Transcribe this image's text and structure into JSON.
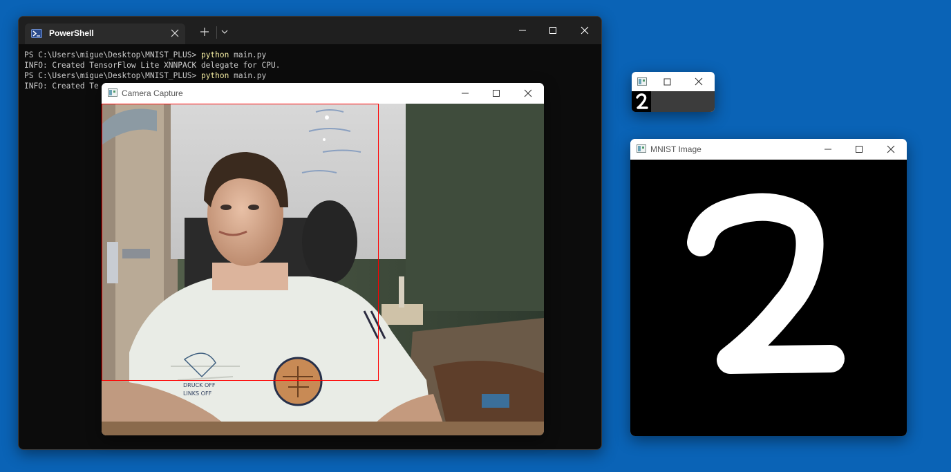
{
  "terminal": {
    "tab_label": "PowerShell",
    "tab_icon": "powershell-icon",
    "lines": [
      {
        "prompt": "PS C:\\Users\\migue\\Desktop\\MNIST_PLUS> ",
        "cmd": "python",
        "args": " main.py"
      },
      {
        "text": "INFO: Created TensorFlow Lite XNNPACK delegate for CPU."
      },
      {
        "prompt": "PS C:\\Users\\migue\\Desktop\\MNIST_PLUS> ",
        "cmd": "python",
        "args": " main.py"
      },
      {
        "text": "INFO: Created Te"
      }
    ],
    "colors": {
      "background": "#0c0c0c",
      "text": "#cccccc",
      "command": "#f9f1a5"
    }
  },
  "camera_window": {
    "title": "Camera Capture",
    "roi_color": "#ff0000"
  },
  "prediction_window": {
    "digit": "2"
  },
  "mnist_window": {
    "title": "MNIST Image",
    "digit": "2"
  },
  "desktop": {
    "background": "#0a63b6"
  }
}
